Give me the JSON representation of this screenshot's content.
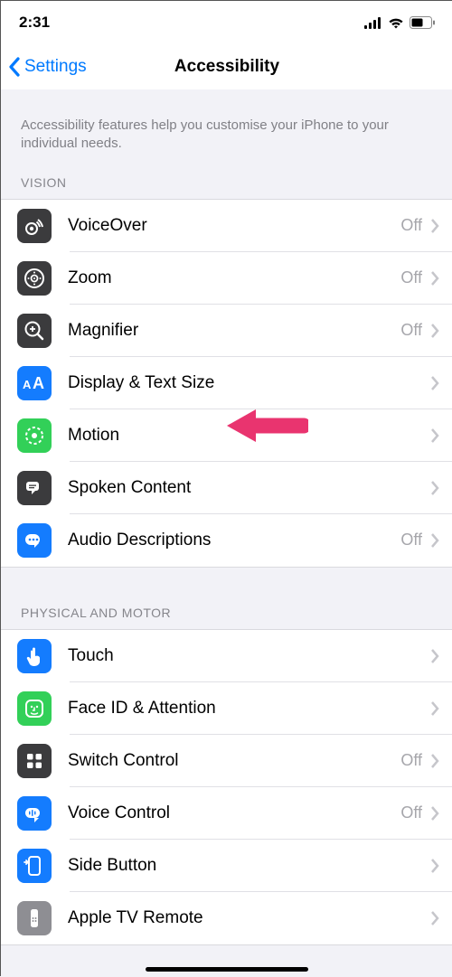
{
  "status_bar": {
    "time": "2:31"
  },
  "header": {
    "back_label": "Settings",
    "title": "Accessibility"
  },
  "intro": "Accessibility features help you customise your iPhone to your individual needs.",
  "sections": {
    "vision": {
      "title": "VISION"
    },
    "physical": {
      "title": "PHYSICAL AND MOTOR"
    }
  },
  "rows": {
    "voiceover": {
      "label": "VoiceOver",
      "status": "Off"
    },
    "zoom": {
      "label": "Zoom",
      "status": "Off"
    },
    "magnifier": {
      "label": "Magnifier",
      "status": "Off"
    },
    "display_text": {
      "label": "Display & Text Size",
      "status": ""
    },
    "motion": {
      "label": "Motion",
      "status": ""
    },
    "spoken_content": {
      "label": "Spoken Content",
      "status": ""
    },
    "audio_desc": {
      "label": "Audio Descriptions",
      "status": "Off"
    },
    "touch": {
      "label": "Touch",
      "status": ""
    },
    "face_id": {
      "label": "Face ID & Attention",
      "status": ""
    },
    "switch_control": {
      "label": "Switch Control",
      "status": "Off"
    },
    "voice_control": {
      "label": "Voice Control",
      "status": "Off"
    },
    "side_button": {
      "label": "Side Button",
      "status": ""
    },
    "apple_tv_remote": {
      "label": "Apple TV Remote",
      "status": ""
    }
  }
}
